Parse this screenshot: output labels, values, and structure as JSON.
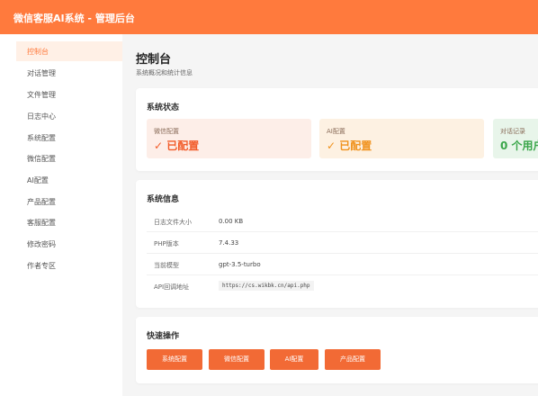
{
  "header": {
    "title": "微信客服AI系统 - 管理后台"
  },
  "sidebar": {
    "items": [
      {
        "label": "控制台",
        "active": true
      },
      {
        "label": "对话管理"
      },
      {
        "label": "文件管理"
      },
      {
        "label": "日志中心"
      },
      {
        "label": "系统配置"
      },
      {
        "label": "微信配置"
      },
      {
        "label": "AI配置"
      },
      {
        "label": "产品配置"
      },
      {
        "label": "客服配置"
      },
      {
        "label": "修改密码"
      },
      {
        "label": "作者专区"
      }
    ]
  },
  "page": {
    "title": "控制台",
    "subtitle": "系统概况和统计信息"
  },
  "status": {
    "title": "系统状态",
    "cards": [
      {
        "label": "微信配置",
        "value": "✓ 已配置"
      },
      {
        "label": "AI配置",
        "value": "✓ 已配置"
      },
      {
        "label": "对话记录",
        "value": "0 个用户"
      }
    ]
  },
  "info": {
    "title": "系统信息",
    "rows": [
      {
        "key": "日志文件大小",
        "value": "0.00 KB"
      },
      {
        "key": "PHP版本",
        "value": "7.4.33"
      },
      {
        "key": "当前模型",
        "value": "gpt-3.5-turbo"
      },
      {
        "key": "API回调地址",
        "value": "https://cs.wikbk.cn/api.php"
      }
    ]
  },
  "quick": {
    "title": "快速操作",
    "buttons": [
      "系统配置",
      "微信配置",
      "AI配置",
      "产品配置"
    ]
  },
  "colors": {
    "accent": "#ff7a3d",
    "button": "#f26a35",
    "ok_green": "#3aa64a",
    "ok_red": "#f25c2a",
    "ok_orange": "#f0921d"
  }
}
